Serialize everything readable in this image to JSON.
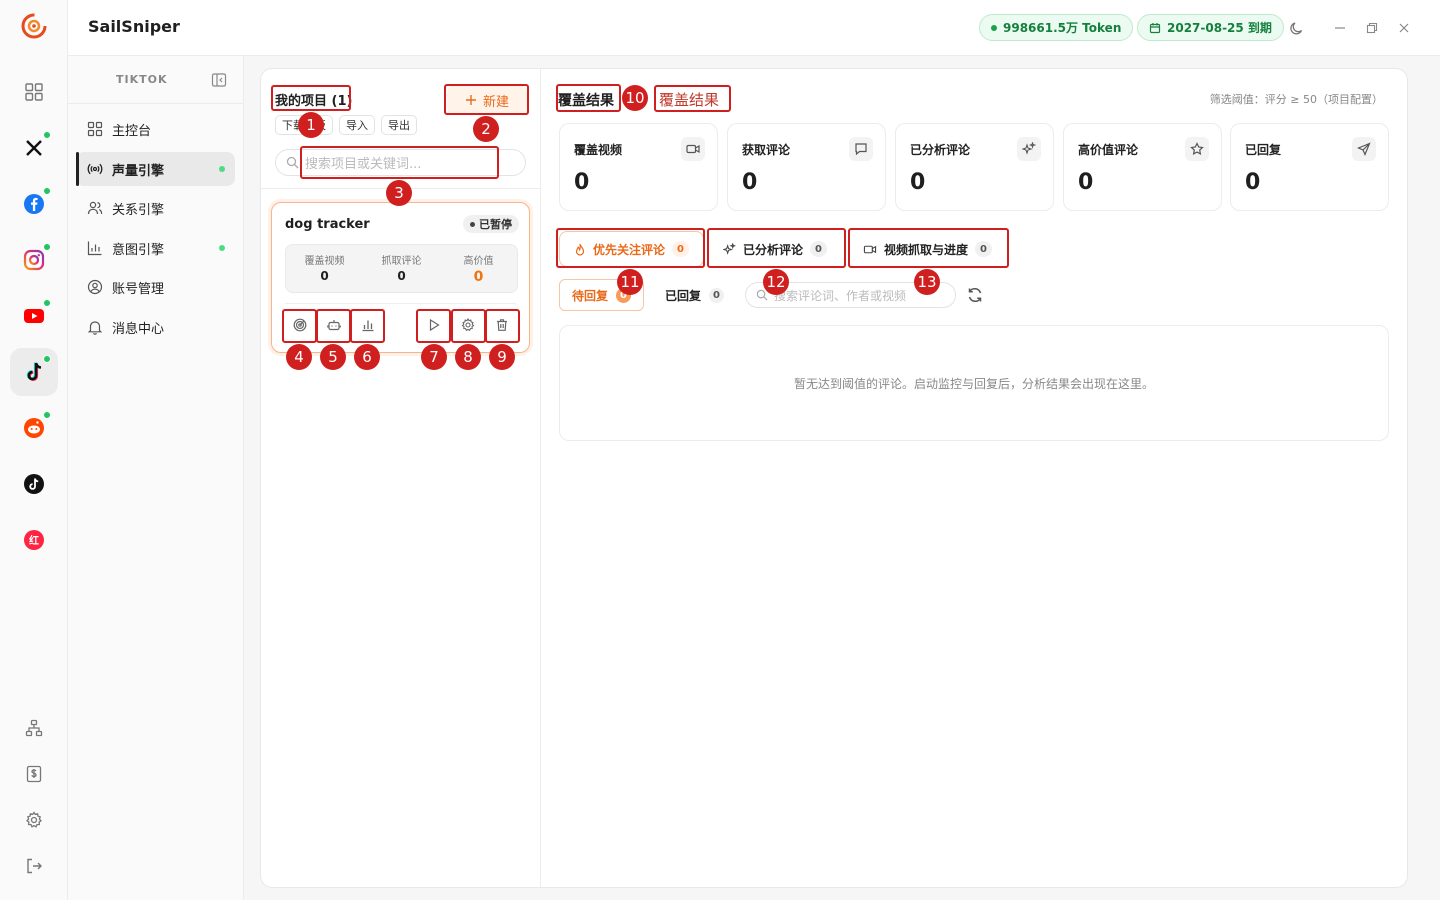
{
  "app": {
    "name": "SailSniper"
  },
  "header": {
    "token": "998661.5万 Token",
    "expiry": "2027-08-25 到期"
  },
  "sidebar": {
    "section": "TIKTOK",
    "items": [
      {
        "label": "主控台"
      },
      {
        "label": "声量引擎"
      },
      {
        "label": "关系引擎"
      },
      {
        "label": "意图引擎"
      },
      {
        "label": "账号管理"
      },
      {
        "label": "消息中心"
      }
    ]
  },
  "projects": {
    "title": "我的项目 (1)",
    "new_label": "新建",
    "download_label": "下载模板",
    "import_label": "导入",
    "export_label": "导出",
    "search_placeholder": "搜索项目或关键词...",
    "card": {
      "name": "dog tracker",
      "status": "已暂停",
      "stats": [
        {
          "label": "覆盖视频",
          "value": "0"
        },
        {
          "label": "抓取评论",
          "value": "0"
        },
        {
          "label": "高价值",
          "value": "0"
        }
      ]
    }
  },
  "results": {
    "title": "覆盖结果",
    "title_annotation": "覆盖结果",
    "threshold": "筛选阈值：评分 ≥ 50（项目配置）",
    "kpis": [
      {
        "label": "覆盖视频",
        "value": "0",
        "icon": "video-icon"
      },
      {
        "label": "获取评论",
        "value": "0",
        "icon": "comment-icon"
      },
      {
        "label": "已分析评论",
        "value": "0",
        "icon": "sparkle-icon"
      },
      {
        "label": "高价值评论",
        "value": "0",
        "icon": "star-icon"
      },
      {
        "label": "已回复",
        "value": "0",
        "icon": "send-icon"
      }
    ],
    "tabs": [
      {
        "label": "优先关注评论",
        "count": "0"
      },
      {
        "label": "已分析评论",
        "count": "0"
      },
      {
        "label": "视频抓取与进度",
        "count": "0"
      }
    ],
    "subtabs": [
      {
        "label": "待回复",
        "count": "0"
      },
      {
        "label": "已回复",
        "count": "0"
      }
    ],
    "comment_search_placeholder": "搜索评论词、作者或视频",
    "empty": "暂无达到阈值的评论。启动监控与回复后，分析结果会出现在这里。"
  },
  "markers": [
    "1",
    "2",
    "3",
    "4",
    "5",
    "6",
    "7",
    "8",
    "9",
    "10",
    "11",
    "12",
    "13"
  ],
  "colors": {
    "accent": "#ea6a1a",
    "marker": "#d01f1f",
    "online": "#22c55e"
  }
}
